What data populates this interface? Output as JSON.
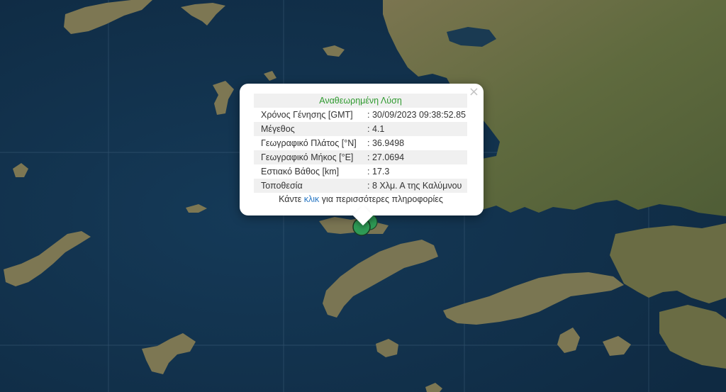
{
  "popup": {
    "title": "Αναθεωρημένη Λύση",
    "close_label": "×",
    "rows": [
      {
        "label": "Χρόνος Γένησης [GMT]",
        "value": ": 30/09/2023 09:38:52.85"
      },
      {
        "label": "Μέγεθος",
        "value": ": 4.1"
      },
      {
        "label": "Γεωγραφικό Πλάτος [°N]",
        "value": ": 36.9498"
      },
      {
        "label": "Γεωγραφικό Μήκος [°E]",
        "value": ": 27.0694"
      },
      {
        "label": "Εστιακό Βάθος [km]",
        "value": ": 17.3"
      },
      {
        "label": "Τοποθεσία",
        "value": ": 8 Χλμ. Α της Καλύμνου"
      }
    ],
    "more_prefix": "Κάντε",
    "more_link": "κλικ",
    "more_suffix": "για περισσότερες πληροφορίες"
  },
  "colors": {
    "sea": "#12304a",
    "land": "#6c6a48",
    "marker": "#2e9a55",
    "title": "#2f9a2f",
    "link": "#2a78c4"
  },
  "icons": [
    "close-icon",
    "earthquake-marker-icon"
  ]
}
